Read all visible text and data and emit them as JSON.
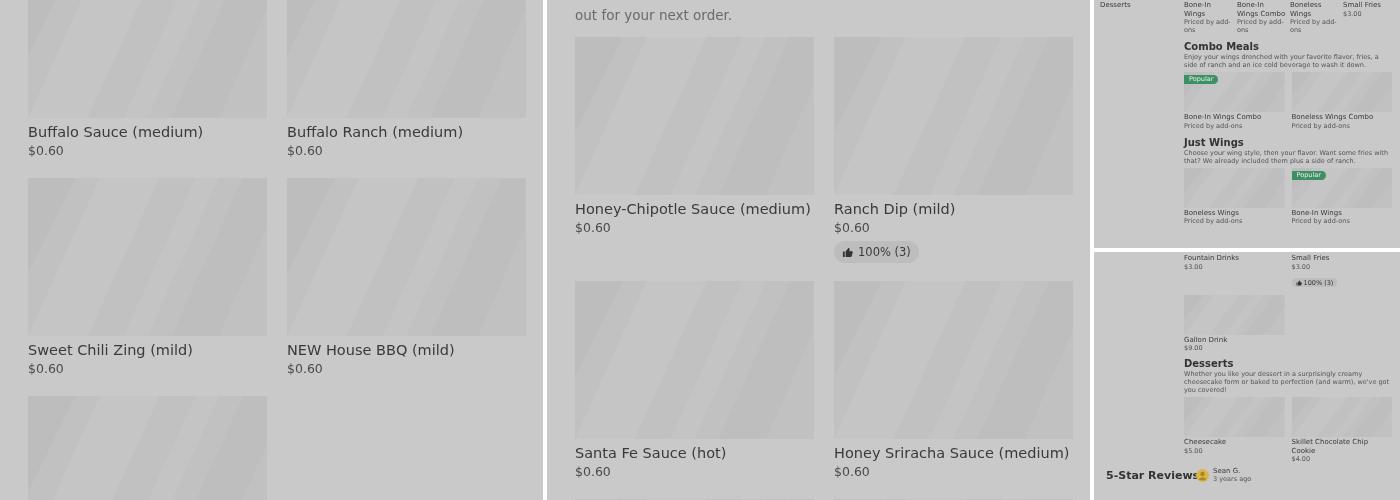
{
  "panels": [
    {
      "kind": "large",
      "sections": [
        {
          "items": [
            {
              "kind": "card",
              "name": "Buffalo Sauce (medium)",
              "price": "$0.60"
            },
            {
              "kind": "card",
              "name": "Buffalo Ranch (medium)",
              "price": "$0.60"
            },
            {
              "kind": "card",
              "name": "Sweet Chili Zing (mild)",
              "price": "$0.60"
            },
            {
              "kind": "card",
              "name": "NEW House BBQ (mild)",
              "price": "$0.60"
            },
            {
              "kind": "card"
            }
          ]
        }
      ]
    },
    {
      "kind": "large",
      "intro": "out for your next order.",
      "sections": [
        {
          "items": [
            {
              "kind": "card",
              "name": "Honey-Chipotle Sauce (medium)",
              "price": "$0.60"
            },
            {
              "kind": "card",
              "name": "Ranch Dip (mild)",
              "price": "$0.60",
              "rating": "100% (3)"
            },
            {
              "kind": "card",
              "name": "Santa Fe Sauce (hot)",
              "price": "$0.60"
            },
            {
              "kind": "card",
              "name": "Honey Sriracha Sauce (medium)",
              "price": "$0.60"
            },
            {
              "kind": "card"
            },
            {
              "kind": "card"
            }
          ]
        }
      ]
    },
    {
      "kind": "small",
      "nav": [
        "Desserts"
      ],
      "sections": [
        {
          "items": [
            {
              "kind": "plain",
              "name": "Bone-In Wings",
              "price": "Priced by add-ons"
            },
            {
              "kind": "plain",
              "name": "Bone-In Wings Combo",
              "price": "Priced by add-ons"
            },
            {
              "kind": "plain",
              "name": "Boneless Wings",
              "price": "Priced by add-ons"
            },
            {
              "kind": "plain",
              "name": "Small Fries",
              "price": "$3.00"
            }
          ]
        },
        {
          "heading": "Combo Meals",
          "description": "Enjoy your wings drenched with your favorite flavor, fries, a side of ranch and an ice cold beverage to wash it down.",
          "items": [
            {
              "kind": "card",
              "badge": "Popular",
              "name": "Bone-In Wings Combo",
              "price": "Priced by add-ons"
            },
            {
              "kind": "card",
              "name": "Boneless Wings Combo",
              "price": "Priced by add-ons"
            }
          ]
        },
        {
          "heading": "Just Wings",
          "description": "Choose your wing style, then your flavor. Want some fries with that? We already included them plus a side of ranch.",
          "items": [
            {
              "kind": "card",
              "name": "Boneless Wings",
              "price": "Priced by add-ons"
            },
            {
              "kind": "card",
              "badge": "Popular",
              "name": "Bone-In Wings",
              "price": "Priced by add-ons"
            }
          ]
        }
      ]
    },
    {
      "kind": "small",
      "sections": [
        {
          "items": [
            {
              "kind": "plain",
              "name": "Fountain Drinks",
              "price": "$3.00"
            },
            {
              "kind": "plain",
              "name": "Small Fries",
              "price": "$3.00",
              "rating": "100% (3)"
            },
            {
              "kind": "card",
              "name": "Gallon Drink",
              "price": "$9.00"
            }
          ]
        },
        {
          "heading": "Desserts",
          "description": "Whether you like your dessert in a surprisingly creamy cheesecake form or baked to perfection (and warm), we've got you covered!",
          "items": [
            {
              "kind": "card",
              "name": "Cheesecake",
              "price": "$5.00"
            },
            {
              "kind": "card",
              "name": "Skillet Chocolate Chip Cookie",
              "price": "$4.00"
            }
          ]
        }
      ],
      "reviews": {
        "heading": "5-Star Reviews",
        "items": [
          {
            "author": "Sean G.",
            "time": "3 years ago"
          }
        ]
      }
    }
  ]
}
